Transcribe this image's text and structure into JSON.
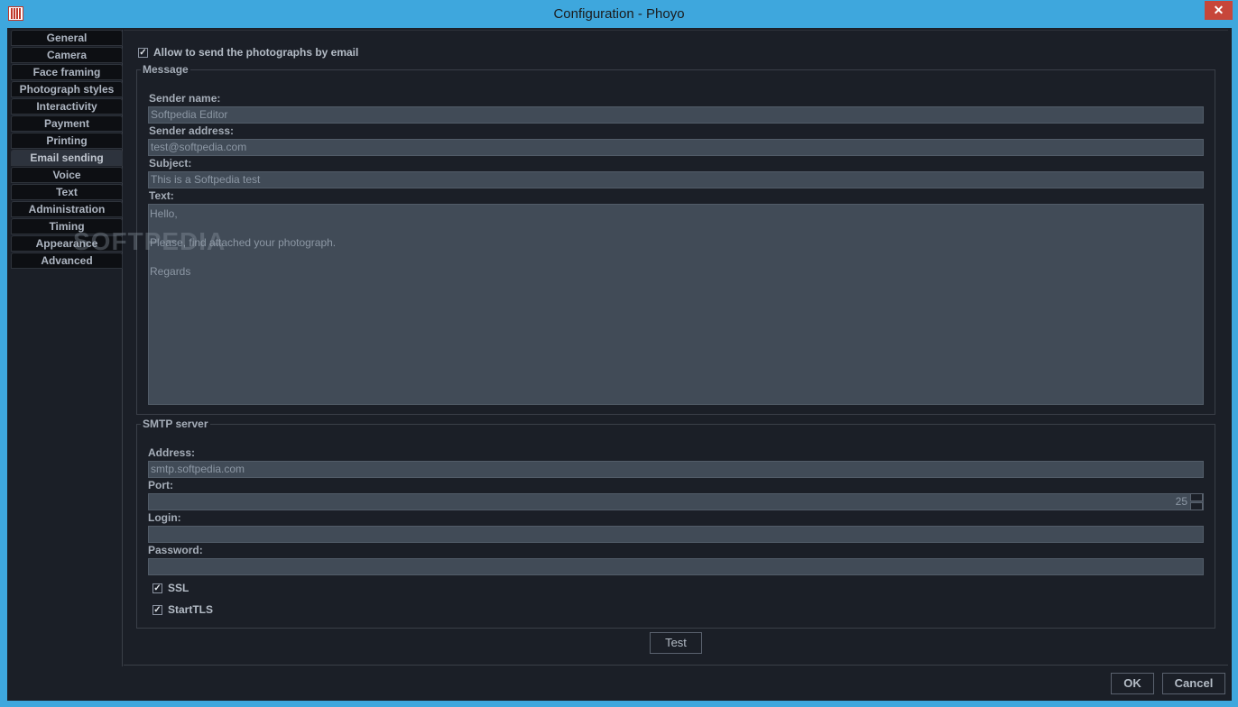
{
  "window": {
    "title": "Configuration - Phoyo",
    "close_glyph": "✕"
  },
  "sidebar": {
    "tabs": [
      {
        "label": "General"
      },
      {
        "label": "Camera"
      },
      {
        "label": "Face framing"
      },
      {
        "label": "Photograph styles"
      },
      {
        "label": "Interactivity"
      },
      {
        "label": "Payment"
      },
      {
        "label": "Printing"
      },
      {
        "label": "Email sending",
        "active": true
      },
      {
        "label": "Voice"
      },
      {
        "label": "Text"
      },
      {
        "label": "Administration"
      },
      {
        "label": "Timing"
      },
      {
        "label": "Appearance"
      },
      {
        "label": "Advanced"
      }
    ]
  },
  "email": {
    "allow_label": "Allow to send the photographs by email",
    "allow_checked": true,
    "message": {
      "legend": "Message",
      "sender_name_label": "Sender name:",
      "sender_name_value": "Softpedia Editor",
      "sender_address_label": "Sender address:",
      "sender_address_value": "test@softpedia.com",
      "subject_label": "Subject:",
      "subject_value": "This is a Softpedia test",
      "text_label": "Text:",
      "text_value": "Hello,\n\nPlease, find attached your photograph.\n\nRegards"
    },
    "smtp": {
      "legend": "SMTP server",
      "address_label": "Address:",
      "address_value": "smtp.softpedia.com",
      "port_label": "Port:",
      "port_value": "25",
      "login_label": "Login:",
      "login_value": "",
      "password_label": "Password:",
      "password_value": "",
      "ssl_label": "SSL",
      "ssl_checked": true,
      "starttls_label": "StartTLS",
      "starttls_checked": true
    },
    "test_button": "Test"
  },
  "footer": {
    "ok_label": "OK",
    "cancel_label": "Cancel"
  },
  "watermark": "SOFTPEDIA",
  "check_glyph": "✓",
  "colors": {
    "title_bar": "#3ea7dd",
    "background": "#1b1f27",
    "field_bg": "#414b57",
    "close_button": "#c7463a"
  }
}
